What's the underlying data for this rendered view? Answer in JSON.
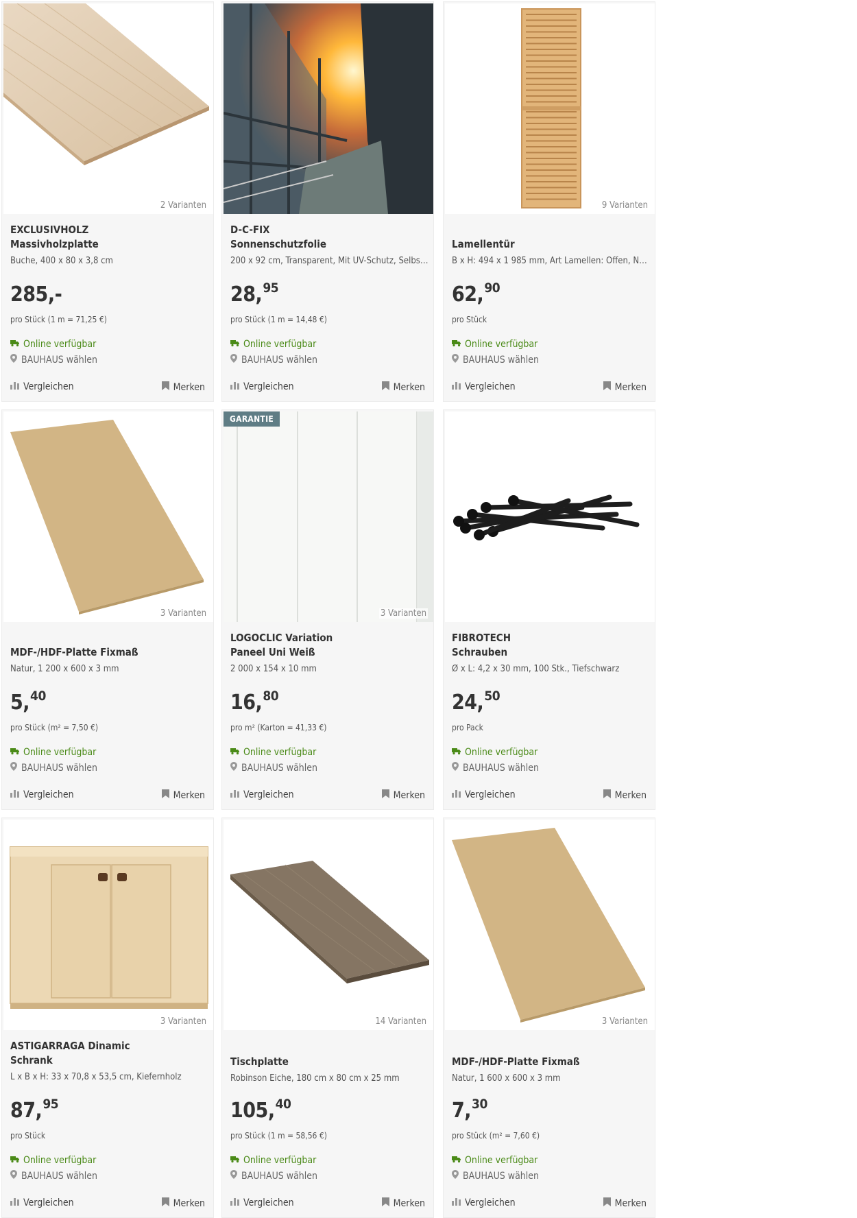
{
  "labels": {
    "online": "Online verfügbar",
    "store": "BAUHAUS wählen",
    "compare": "Vergleichen",
    "remember": "Merken"
  },
  "colors": {
    "online_green": "#4a8a17",
    "badge": "#5f7d85"
  },
  "products": [
    {
      "brand": "EXCLUSIVHOLZ",
      "name": "Massivholzplatte",
      "desc": "Buche, 400 x 80 x 3,8 cm",
      "price_main": "285,-",
      "price_cents": "",
      "unit": "pro Stück (1 m = 71,25 €)",
      "variants": "2 Varianten",
      "badge": "",
      "image": "wood-worktop-icon"
    },
    {
      "brand": "D-C-FIX",
      "name": "Sonnenschutzfolie",
      "desc": "200 x 92 cm, Transparent, Mit UV-Schutz, Selbst...",
      "price_main": "28,",
      "price_cents": "95",
      "unit": "pro Stück (1 m = 14,48 €)",
      "variants": "",
      "badge": "",
      "image": "sunlit-glass-facade-icon"
    },
    {
      "brand": "",
      "name": "Lamellentür",
      "desc": "B x H: 494 x 1 985 mm, Art Lamellen: Offen, Na...",
      "price_main": "62,",
      "price_cents": "90",
      "unit": "pro Stück",
      "variants": "9 Varianten",
      "badge": "",
      "image": "louvred-door-icon"
    },
    {
      "brand": "",
      "name": "MDF-/HDF-Platte Fixmaß",
      "desc": "Natur, 1 200 x 600 x 3 mm",
      "price_main": "5,",
      "price_cents": "40",
      "unit": "pro Stück (m² = 7,50 €)",
      "variants": "3 Varianten",
      "badge": "",
      "image": "mdf-board-icon"
    },
    {
      "brand": "LOGOCLIC Variation",
      "name": "Paneel Uni Weiß",
      "desc": "2 000 x 154 x 10 mm",
      "price_main": "16,",
      "price_cents": "80",
      "unit": "pro m² (Karton = 41,33 €)",
      "variants": "3 Varianten",
      "badge": "GARANTIE",
      "image": "white-panel-icon"
    },
    {
      "brand": "FIBROTECH",
      "name": "Schrauben",
      "desc": "Ø x L: 4,2 x 30 mm, 100 Stk., Tiefschwarz",
      "price_main": "24,",
      "price_cents": "50",
      "unit": "pro Pack",
      "variants": "",
      "badge": "",
      "image": "black-screws-icon"
    },
    {
      "brand": "ASTIGARRAGA Dinamic",
      "name": "Schrank",
      "desc": "L x B x H: 33 x 70,8 x 53,5 cm, Kiefernholz",
      "price_main": "87,",
      "price_cents": "95",
      "unit": "pro Stück",
      "variants": "3 Varianten",
      "badge": "",
      "image": "pine-cabinet-icon"
    },
    {
      "brand": "",
      "name": "Tischplatte",
      "desc": "Robinson Eiche, 180 cm x 80 cm x 25 mm",
      "price_main": "105,",
      "price_cents": "40",
      "unit": "pro Stück (1 m = 58,56 €)",
      "variants": "14 Varianten",
      "badge": "",
      "image": "table-top-icon"
    },
    {
      "brand": "",
      "name": "MDF-/HDF-Platte Fixmaß",
      "desc": "Natur, 1 600 x 600 x 3 mm",
      "price_main": "7,",
      "price_cents": "30",
      "unit": "pro Stück (m² = 7,60 €)",
      "variants": "3 Varianten",
      "badge": "",
      "image": "mdf-board-icon"
    }
  ]
}
